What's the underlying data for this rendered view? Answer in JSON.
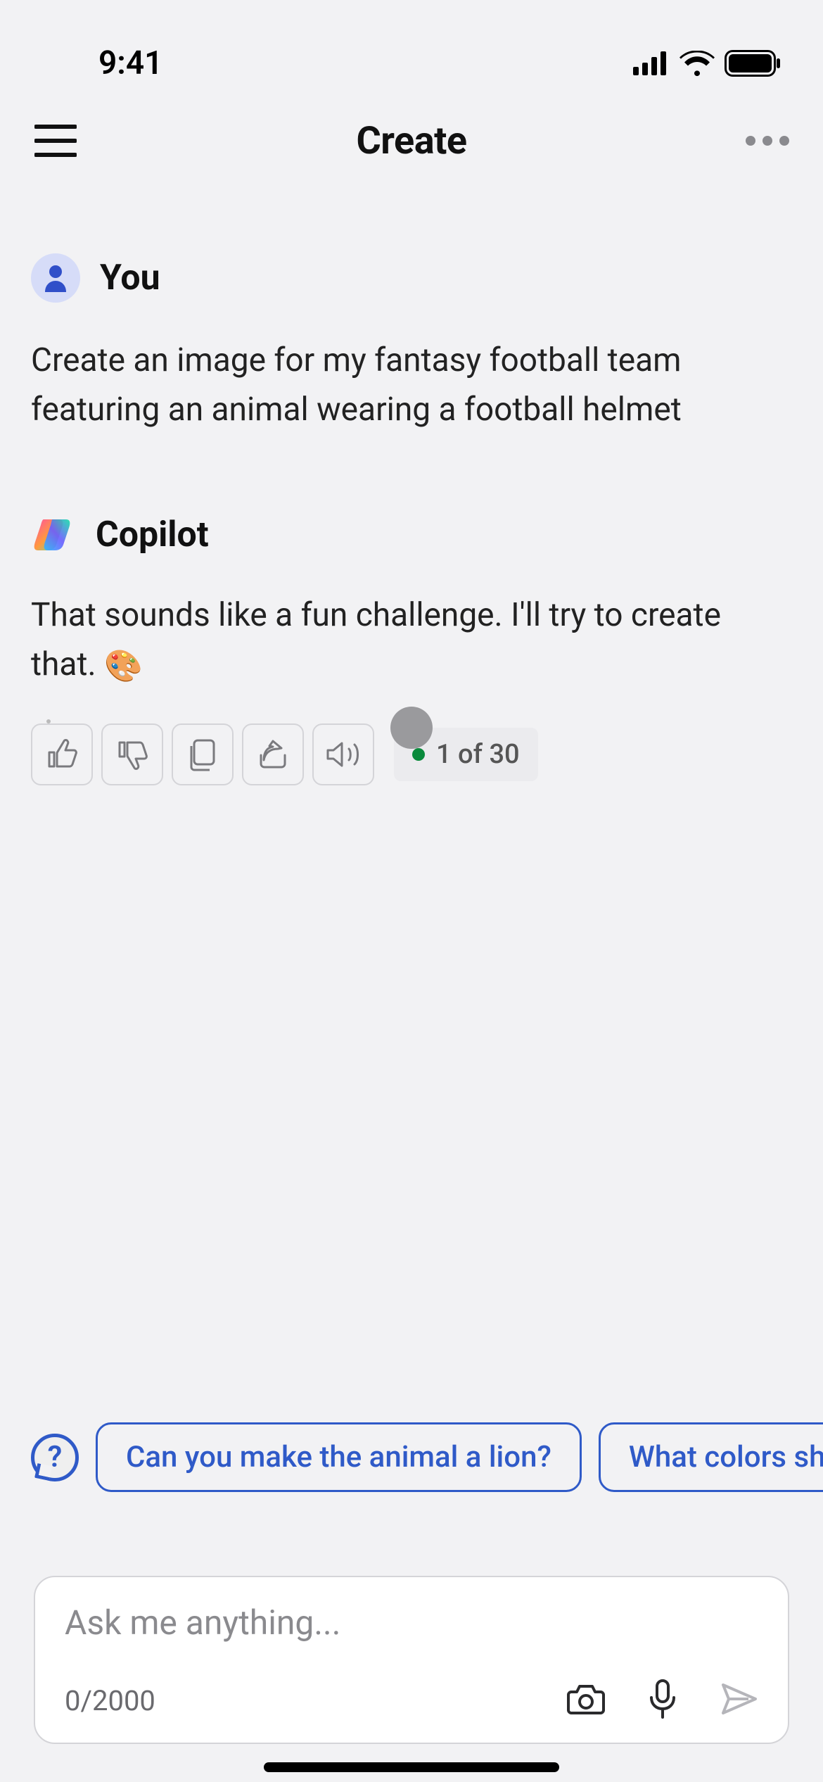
{
  "status_bar": {
    "time": "9:41"
  },
  "nav": {
    "title": "Create"
  },
  "conversation": {
    "user": {
      "sender": "You",
      "body": "Create an image for my fantasy football team featuring an animal wearing a football helmet"
    },
    "copilot": {
      "sender": "Copilot",
      "body_prefix": "That sounds like a fun challenge. I'll try to create that. ",
      "emoji": "🎨"
    }
  },
  "actions": {
    "counter": "1 of 30"
  },
  "suggestions": {
    "items": [
      "Can you make the animal a lion?",
      "What colors sh"
    ]
  },
  "composer": {
    "placeholder": "Ask me anything...",
    "char_count": "0/2000"
  }
}
